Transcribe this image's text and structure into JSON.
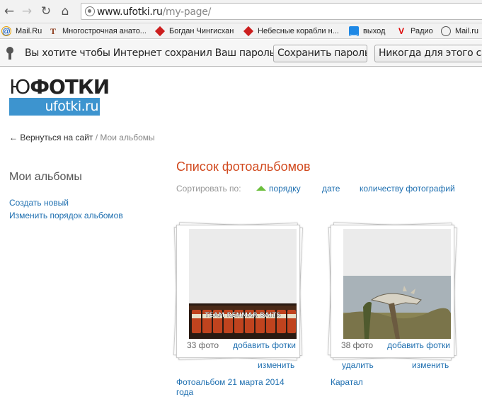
{
  "browser": {
    "url_host": "www.ufotki.ru",
    "url_path": "/my-page/",
    "bookmarks": [
      {
        "label": "Mail.Ru",
        "icon": "mail-ru-icon"
      },
      {
        "label": "Многострочная анато...",
        "icon": "t-icon"
      },
      {
        "label": "Богдан Чингисхан",
        "icon": "diamond-icon"
      },
      {
        "label": "Небесные корабли н...",
        "icon": "diamond-icon"
      },
      {
        "label": "выход",
        "icon": "smile-icon"
      },
      {
        "label": "Радио",
        "icon": "v-icon"
      },
      {
        "label": "Mail.ru",
        "icon": "globe-icon"
      }
    ]
  },
  "infobar": {
    "message": "Вы хотите чтобы Интернет сохранил Ваш пароль?",
    "save_label": "Сохранить пароль",
    "never_label": "Никогда для этого сайта"
  },
  "logo": {
    "yu": "Ю",
    "rest": "ФОТКИ",
    "sub": "ufotki.ru"
  },
  "breadcrumb": {
    "back": "← Вернуться на сайт",
    "sep": " / ",
    "current": "Мои альбомы"
  },
  "sidebar": {
    "title": "Мои альбомы",
    "create": "Создать новый",
    "reorder": "Изменить порядок альбомов"
  },
  "main": {
    "title": "Список фотоальбомов",
    "sort_label": "Сортировать по:",
    "sort_order": "порядку",
    "sort_date": "дате",
    "sort_count": "количеству фотографий"
  },
  "albums": [
    {
      "count": "33 фото",
      "add": "добавить фотки",
      "edit": "изменить",
      "name": "Фотоальбом 21 марта 2014 года",
      "photo_text": "TEAM RENMAR BAITS"
    },
    {
      "count": "38 фото",
      "add": "добавить фотки",
      "delete": "удалить",
      "edit": "изменить",
      "name": "Каратал"
    }
  ],
  "colors": {
    "accent_link": "#1e6fb0",
    "title_orange": "#d14a1f",
    "logo_blue": "#3d94cf",
    "sort_active": "#6cbf3d"
  }
}
